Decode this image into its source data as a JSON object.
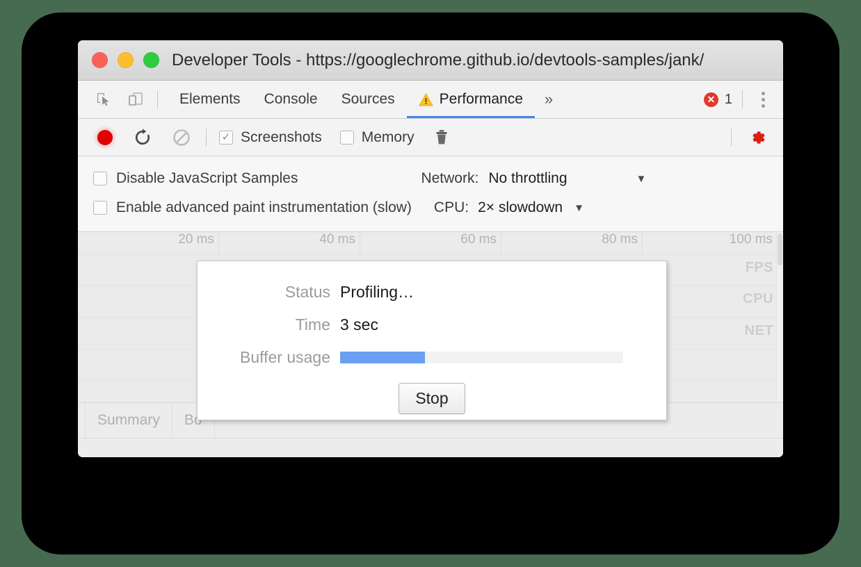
{
  "window": {
    "title": "Developer Tools - https://googlechrome.github.io/devtools-samples/jank/",
    "traffic_lights": [
      "close",
      "minimize",
      "zoom"
    ]
  },
  "tabbar": {
    "inspect_icon": "inspect-element-icon",
    "device_icon": "device-toolbar-icon",
    "tabs": [
      {
        "label": "Elements",
        "active": false,
        "warning": false
      },
      {
        "label": "Console",
        "active": false,
        "warning": false
      },
      {
        "label": "Sources",
        "active": false,
        "warning": false
      },
      {
        "label": "Performance",
        "active": true,
        "warning": true
      }
    ],
    "overflow_label": "»",
    "error_badge": {
      "icon": "error-circle-icon",
      "count": "1"
    },
    "menu_icon": "kebab-menu-icon"
  },
  "toolbar": {
    "record_icon": "record-button",
    "reload_icon": "reload-and-record-icon",
    "clear_icon": "clear-recording-icon",
    "screenshots": {
      "label": "Screenshots",
      "checked": true,
      "tick": "✓"
    },
    "memory": {
      "label": "Memory",
      "checked": false
    },
    "trash_icon": "collect-garbage-icon",
    "settings_icon": "capture-settings-gear-icon",
    "settings_icon_color": "#d91f11"
  },
  "capture_settings": {
    "disable_js_samples": {
      "label": "Disable JavaScript Samples",
      "checked": false
    },
    "advanced_paint": {
      "label": "Enable advanced paint instrumentation (slow)",
      "checked": false
    },
    "network": {
      "label": "Network:",
      "value": "No throttling",
      "caret": "▼"
    },
    "cpu": {
      "label": "CPU:",
      "value": "2× slowdown",
      "caret": "▼"
    }
  },
  "timeline": {
    "ruler_ticks": [
      "20 ms",
      "40 ms",
      "60 ms",
      "80 ms",
      "100 ms"
    ],
    "rows": [
      "FPS",
      "CPU",
      "NET"
    ]
  },
  "bottom_tabs": [
    {
      "label": "Summary"
    },
    {
      "label": "Bo"
    }
  ],
  "modal": {
    "status_label": "Status",
    "status_value": "Profiling…",
    "time_label": "Time",
    "time_value": "3 sec",
    "buffer_label": "Buffer usage",
    "buffer_percent": 30,
    "buffer_fill_color": "#6b9ff2",
    "stop_label": "Stop"
  }
}
